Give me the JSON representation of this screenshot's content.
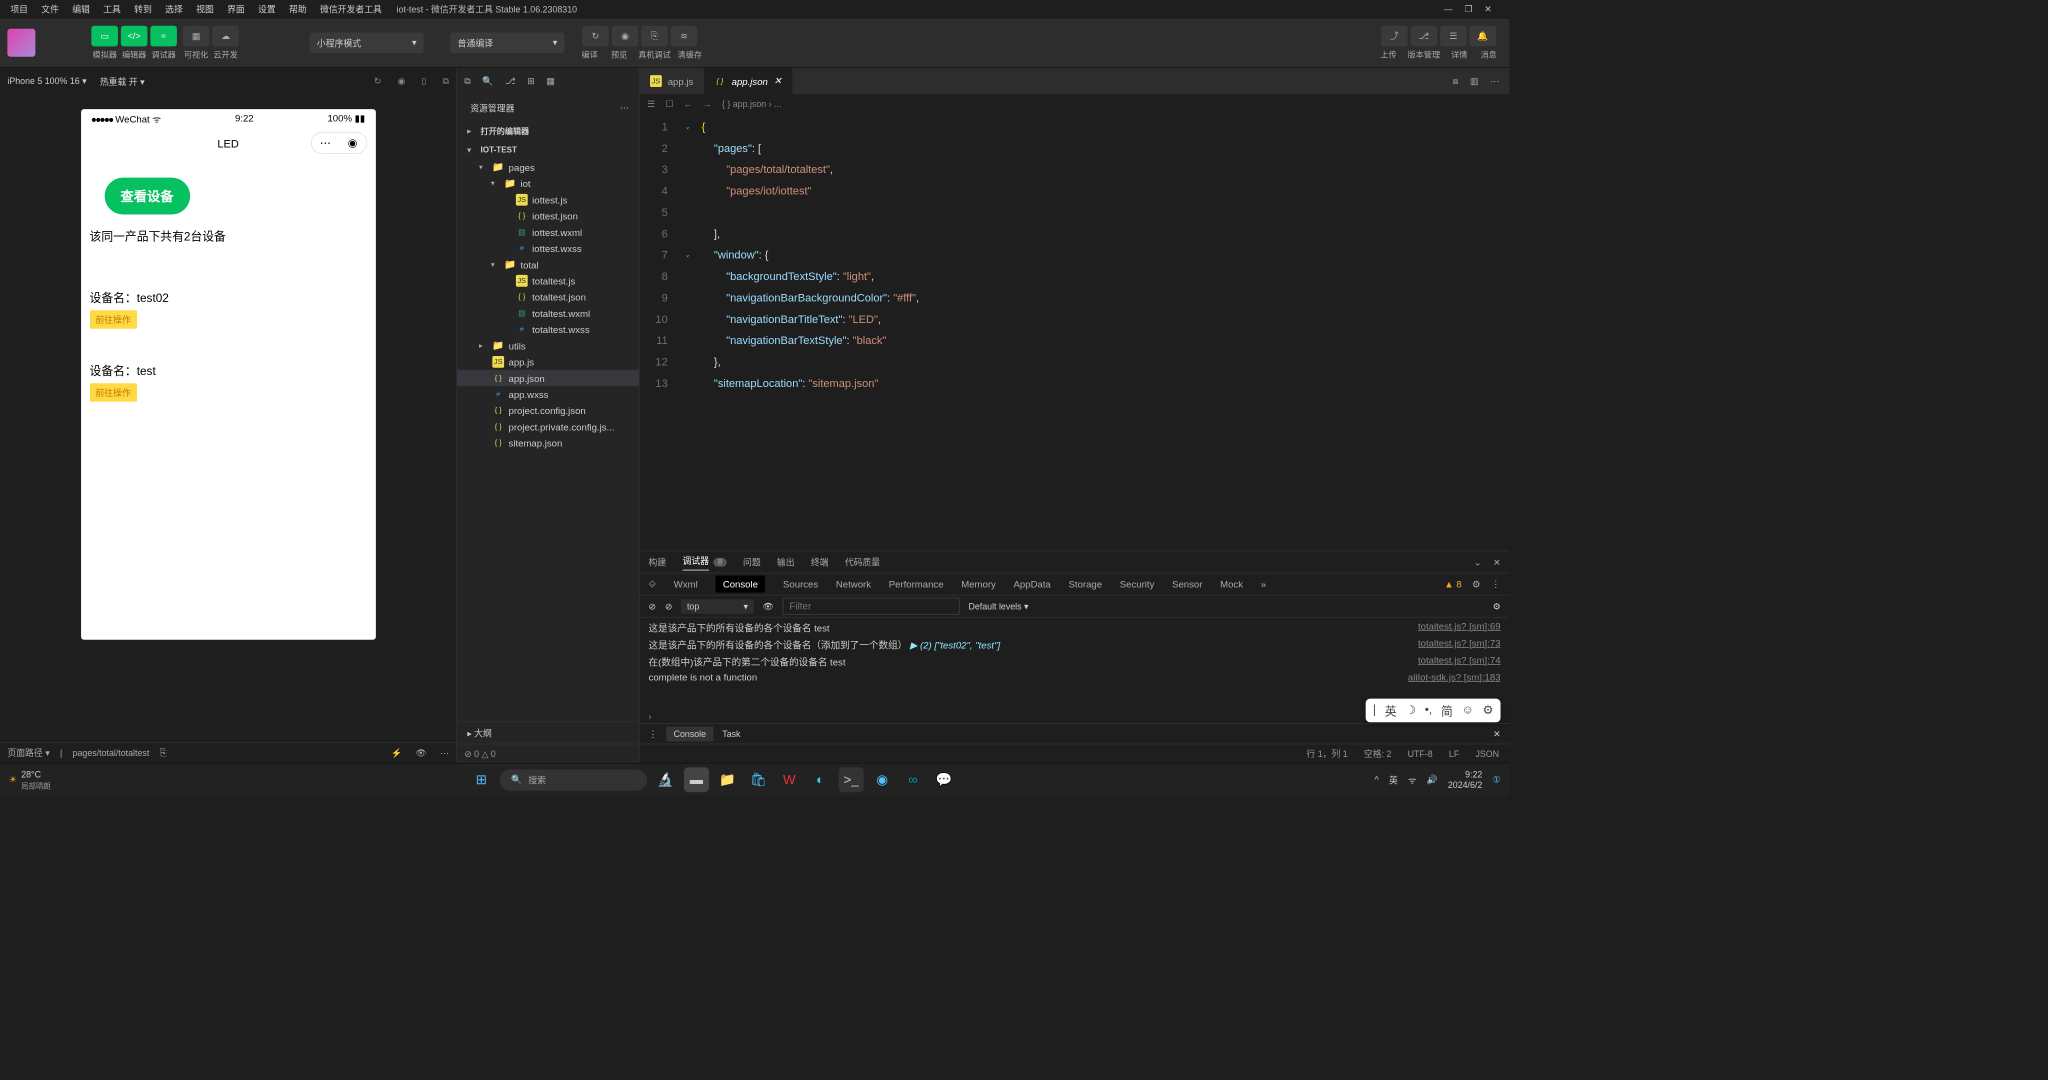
{
  "title": "iot-test - 微信开发者工具 Stable 1.06.2308310",
  "menu": [
    "项目",
    "文件",
    "编辑",
    "工具",
    "转到",
    "选择",
    "视图",
    "界面",
    "设置",
    "帮助",
    "微信开发者工具"
  ],
  "toolbar": {
    "groups": {
      "sim": "模拟器",
      "editor": "编辑器",
      "debug": "调试器",
      "viz": "可视化",
      "cloud": "云开发"
    },
    "mode": "小程序模式",
    "compile": "普通编译",
    "center": {
      "compile_action": "编译",
      "preview": "预览",
      "remote": "真机调试",
      "cache": "清缓存"
    },
    "right": {
      "upload": "上传",
      "version": "版本管理",
      "detail": "详情",
      "msg": "消息"
    }
  },
  "sim": {
    "device": "iPhone 5 100% 16 ▾",
    "hot": "热重载 开 ▾",
    "status_time": "9:22",
    "status_net": "WeChat",
    "battery": "100%",
    "page_title": "LED",
    "view_btn": "查看设备",
    "summary": "该同一产品下共有2台设备",
    "devices": [
      {
        "name": "设备名：test02",
        "action": "前往操作"
      },
      {
        "name": "设备名：test",
        "action": "前往操作"
      }
    ],
    "path_label": "页面路径 ▾",
    "path": "pages/total/totaltest"
  },
  "explorer": {
    "title": "资源管理器",
    "open_editors": "打开的编辑器",
    "project": "IOT-TEST",
    "tree": [
      {
        "l": 1,
        "t": "folder",
        "n": "pages",
        "open": true
      },
      {
        "l": 2,
        "t": "folder",
        "n": "iot",
        "open": true
      },
      {
        "l": 3,
        "t": "js",
        "n": "iottest.js"
      },
      {
        "l": 3,
        "t": "json",
        "n": "iottest.json"
      },
      {
        "l": 3,
        "t": "wxml",
        "n": "iottest.wxml"
      },
      {
        "l": 3,
        "t": "wxss",
        "n": "iottest.wxss"
      },
      {
        "l": 2,
        "t": "folder",
        "n": "total",
        "open": true
      },
      {
        "l": 3,
        "t": "js",
        "n": "totaltest.js"
      },
      {
        "l": 3,
        "t": "json",
        "n": "totaltest.json"
      },
      {
        "l": 3,
        "t": "wxml",
        "n": "totaltest.wxml"
      },
      {
        "l": 3,
        "t": "wxss",
        "n": "totaltest.wxss"
      },
      {
        "l": 1,
        "t": "folder",
        "n": "utils",
        "open": false
      },
      {
        "l": 1,
        "t": "js",
        "n": "app.js"
      },
      {
        "l": 1,
        "t": "json",
        "n": "app.json",
        "sel": true
      },
      {
        "l": 1,
        "t": "wxss",
        "n": "app.wxss"
      },
      {
        "l": 1,
        "t": "json",
        "n": "project.config.json"
      },
      {
        "l": 1,
        "t": "json",
        "n": "project.private.config.js..."
      },
      {
        "l": 1,
        "t": "json",
        "n": "sitemap.json"
      }
    ],
    "outline": "大纲",
    "stats": "⊘ 0 △ 0"
  },
  "editor": {
    "tabs": [
      {
        "icon": "js",
        "name": "app.js",
        "active": false
      },
      {
        "icon": "json",
        "name": "app.json",
        "active": true,
        "close": true
      }
    ],
    "breadcrumb": "{ } app.json › ...",
    "lines": [
      "1",
      "2",
      "3",
      "4",
      "5",
      "6",
      "7",
      "8",
      "9",
      "10",
      "11",
      "12",
      "13"
    ],
    "status": {
      "pos": "行 1，列 1",
      "spaces": "空格: 2",
      "enc": "UTF-8",
      "eol": "LF",
      "lang": "JSON"
    }
  },
  "panel": {
    "tabs": [
      "构建",
      "调试器",
      "问题",
      "输出",
      "终端",
      "代码质量"
    ],
    "tabs_badge": "8",
    "active_tab": "调试器",
    "dev": [
      "Wxml",
      "Console",
      "Sources",
      "Network",
      "Performance",
      "Memory",
      "AppData",
      "Storage",
      "Security",
      "Sensor",
      "Mock"
    ],
    "dev_active": "Console",
    "warn_badge": "▲ 8",
    "console": {
      "context": "top",
      "filter_ph": "Filter",
      "levels": "Default levels ▾",
      "lines": [
        {
          "msg": "这是该产品下的所有设备的各个设备名 test",
          "src": "totaltest.js? [sm]:69"
        },
        {
          "msg": "这是该产品下的所有设备的各个设备名（添加到了一个数组）",
          "extra": "▶ (2) [\"test02\", \"test\"]",
          "src": "totaltest.js? [sm]:73"
        },
        {
          "msg": "在(数组中)该产品下的第二个设备的设备名 test",
          "src": "totaltest.js? [sm]:74"
        },
        {
          "msg": "complete is not a function",
          "src": "aliIot-sdk.js? [sm]:183"
        }
      ]
    },
    "footer": [
      "Console",
      "Task"
    ]
  },
  "ime": {
    "lang": "英",
    "mode": "简"
  },
  "taskbar": {
    "temp": "28°C",
    "weather": "局部晴朗",
    "search_ph": "搜索",
    "tray_lang": "英",
    "time": "9:22",
    "date": "2024/6/2"
  }
}
